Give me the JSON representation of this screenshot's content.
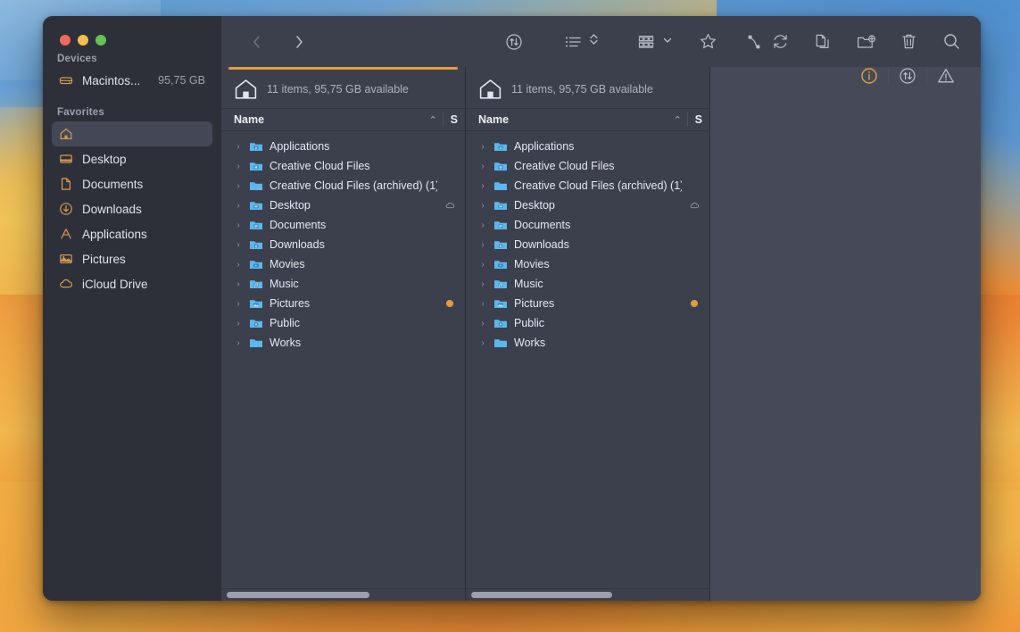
{
  "window": {
    "traffic_lights": [
      {
        "name": "close",
        "color": "#ee6a5f"
      },
      {
        "name": "minimize",
        "color": "#f5bd4f"
      },
      {
        "name": "zoom",
        "color": "#61c454"
      }
    ]
  },
  "sidebar": {
    "sections": [
      {
        "title": "Devices",
        "items": [
          {
            "label": "Macintos...",
            "icon": "harddisk-icon",
            "size": "95,75 GB",
            "selected": false
          }
        ]
      },
      {
        "title": "Favorites",
        "items": [
          {
            "label": "",
            "icon": "home-icon",
            "size": "",
            "selected": true
          },
          {
            "label": "Desktop",
            "icon": "desktop-icon",
            "size": "",
            "selected": false
          },
          {
            "label": "Documents",
            "icon": "document-icon",
            "size": "",
            "selected": false
          },
          {
            "label": "Downloads",
            "icon": "downloads-icon",
            "size": "",
            "selected": false
          },
          {
            "label": "Applications",
            "icon": "applications-icon",
            "size": "",
            "selected": false
          },
          {
            "label": "Pictures",
            "icon": "pictures-icon",
            "size": "",
            "selected": false
          },
          {
            "label": "iCloud Drive",
            "icon": "icloud-icon",
            "size": "",
            "selected": false
          }
        ]
      }
    ]
  },
  "toolbar": {
    "back_label": "chevron-left-icon",
    "forward_label": "chevron-right-icon",
    "items": [
      {
        "name": "transfer-icon",
        "enabled": true
      },
      {
        "name": "list-view-icon",
        "enabled": true
      },
      {
        "name": "grid-view-icon",
        "enabled": true
      },
      {
        "name": "favorite-star-icon",
        "enabled": true
      },
      {
        "name": "connect-icon",
        "enabled": true
      },
      {
        "name": "refresh-icon",
        "enabled": true
      },
      {
        "name": "duplicate-icon",
        "enabled": true
      },
      {
        "name": "new-folder-icon",
        "enabled": true
      },
      {
        "name": "trash-icon",
        "enabled": true
      },
      {
        "name": "search-icon",
        "enabled": true
      }
    ]
  },
  "subtoolbar": {
    "items": [
      {
        "name": "info-icon",
        "active": true
      },
      {
        "name": "transfer-icon",
        "active": false
      },
      {
        "name": "warning-icon",
        "active": false
      }
    ]
  },
  "panes": [
    {
      "active": true,
      "location_icon": "home-icon",
      "status": "11 items, 95,75 GB available",
      "columns": {
        "name": "Name",
        "next": "S",
        "sort": "⌃"
      },
      "items": [
        {
          "name": "Applications",
          "icon": "folder-applications",
          "badge": ""
        },
        {
          "name": "Creative Cloud Files",
          "icon": "folder-creative-cloud",
          "badge": ""
        },
        {
          "name": "Creative Cloud Files (archived) (1)",
          "icon": "folder-plain",
          "badge": ""
        },
        {
          "name": "Desktop",
          "icon": "folder-desktop",
          "badge": "cloud"
        },
        {
          "name": "Documents",
          "icon": "folder-documents",
          "badge": ""
        },
        {
          "name": "Downloads",
          "icon": "folder-downloads",
          "badge": ""
        },
        {
          "name": "Movies",
          "icon": "folder-movies",
          "badge": ""
        },
        {
          "name": "Music",
          "icon": "folder-music",
          "badge": ""
        },
        {
          "name": "Pictures",
          "icon": "folder-pictures",
          "badge": "dot"
        },
        {
          "name": "Public",
          "icon": "folder-public",
          "badge": ""
        },
        {
          "name": "Works",
          "icon": "folder-plain",
          "badge": ""
        }
      ]
    },
    {
      "active": false,
      "location_icon": "home-icon",
      "status": "11 items, 95,75 GB available",
      "columns": {
        "name": "Name",
        "next": "S",
        "sort": "⌃"
      },
      "items": [
        {
          "name": "Applications",
          "icon": "folder-applications",
          "badge": ""
        },
        {
          "name": "Creative Cloud Files",
          "icon": "folder-creative-cloud",
          "badge": ""
        },
        {
          "name": "Creative Cloud Files (archived) (1)",
          "icon": "folder-plain",
          "badge": ""
        },
        {
          "name": "Desktop",
          "icon": "folder-desktop",
          "badge": "cloud"
        },
        {
          "name": "Documents",
          "icon": "folder-documents",
          "badge": ""
        },
        {
          "name": "Downloads",
          "icon": "folder-downloads",
          "badge": ""
        },
        {
          "name": "Movies",
          "icon": "folder-movies",
          "badge": ""
        },
        {
          "name": "Music",
          "icon": "folder-music",
          "badge": ""
        },
        {
          "name": "Pictures",
          "icon": "folder-pictures",
          "badge": "dot"
        },
        {
          "name": "Public",
          "icon": "folder-public",
          "badge": ""
        },
        {
          "name": "Works",
          "icon": "folder-plain",
          "badge": ""
        }
      ]
    }
  ],
  "colors": {
    "accent": "#e0a03c",
    "folder": "#5bb8ef",
    "window_bg": "#3c3f4c",
    "sidebar_bg": "#2e3039",
    "empty_pane_bg": "#464a58"
  }
}
